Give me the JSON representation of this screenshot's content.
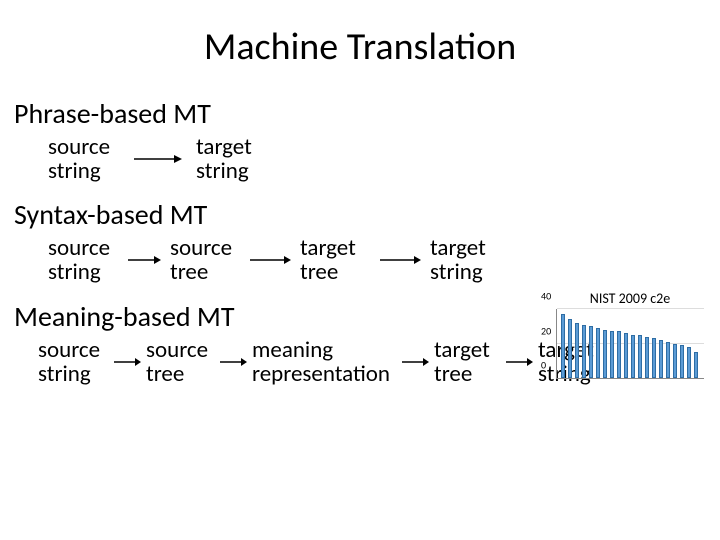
{
  "title": "Machine Translation",
  "sections": {
    "phrase": {
      "heading": "Phrase-based MT",
      "nodes": [
        "source\nstring",
        "target\nstring"
      ]
    },
    "syntax": {
      "heading": "Syntax-based MT",
      "nodes": [
        "source\nstring",
        "source\ntree",
        "target\ntree",
        "target\nstring"
      ]
    },
    "meaning": {
      "heading": "Meaning-based MT",
      "nodes": [
        "source\nstring",
        "source\ntree",
        "meaning\nrepresentation",
        "target\ntree",
        "target\nstring"
      ]
    }
  },
  "chart_data": {
    "type": "bar",
    "title": "NIST 2009 c2e",
    "ylabel": "",
    "xlabel": "",
    "ylim": [
      0,
      40
    ],
    "yticks": [
      0,
      20,
      40
    ],
    "values": [
      37,
      34,
      32,
      31,
      30,
      29,
      28,
      27,
      27,
      26,
      25,
      25,
      24,
      23,
      22,
      21,
      20,
      19,
      18,
      15
    ]
  }
}
